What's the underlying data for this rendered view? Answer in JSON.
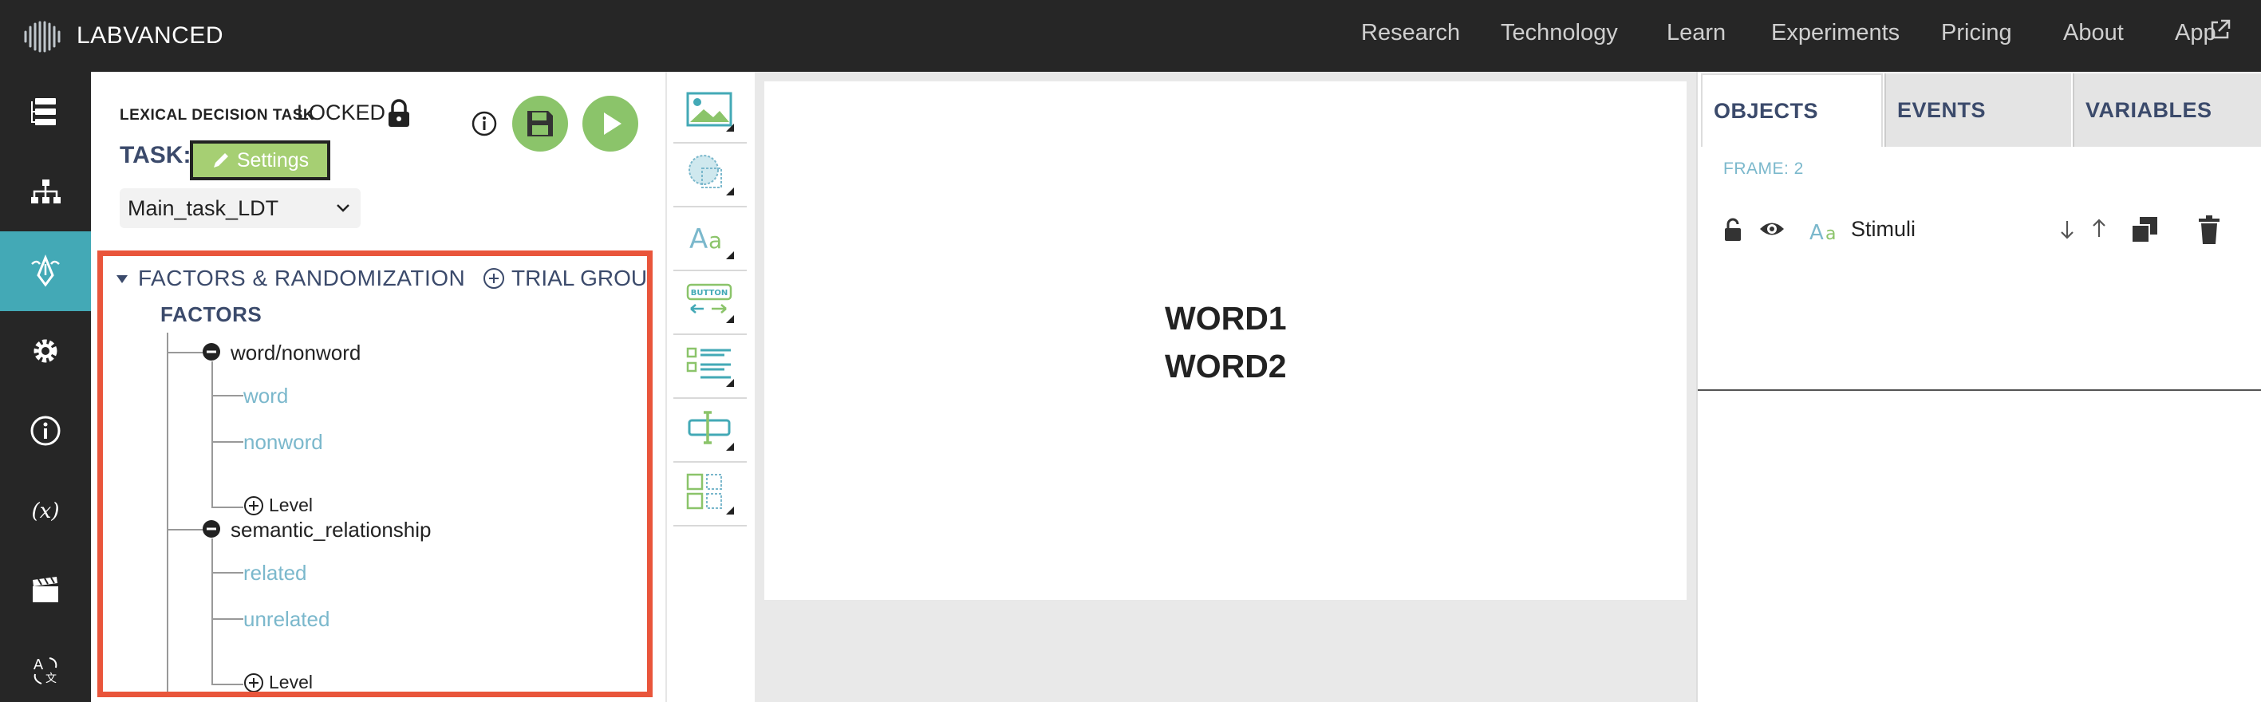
{
  "brand": {
    "name": "LABVANCED"
  },
  "nav": {
    "items": [
      "Research",
      "Technology",
      "Learn",
      "Experiments",
      "Pricing",
      "About",
      "App"
    ]
  },
  "rail": {
    "icons": [
      "structure-icon",
      "tree-icon",
      "task-editor-icon",
      "settings-icon",
      "info-icon",
      "variable-icon",
      "clapper-icon",
      "translate-icon"
    ],
    "active_index": 2,
    "accent": "#43a9b6"
  },
  "task": {
    "name": "LEXICAL DECISION TASK",
    "status": "LOCKED",
    "label": "TASK:",
    "settings_label": "Settings",
    "frame_select_value": "Main_task_LDT"
  },
  "factors_panel": {
    "title": "FACTORS & RANDOMIZATION",
    "trial_group_label": "TRIAL GROUP",
    "factors_label": "FACTORS",
    "factors": [
      {
        "name": "word/nonword",
        "levels": [
          "word",
          "nonword"
        ],
        "add_level_label": "Level"
      },
      {
        "name": "semantic_relationship",
        "levels": [
          "related",
          "unrelated"
        ],
        "add_level_label": "Level"
      }
    ],
    "highlight_color": "#e9553b"
  },
  "tools": [
    "image-tool-icon",
    "shape-tool-icon",
    "text-tool-icon",
    "button-tool-icon",
    "multiple-choice-tool-icon",
    "input-tool-icon",
    "checkbox-tool-icon"
  ],
  "tool_button_text": "BUTTON",
  "canvas": {
    "words": [
      "WORD1",
      "WORD2"
    ]
  },
  "right_panel": {
    "tabs": [
      "OBJECTS",
      "EVENTS",
      "VARIABLES"
    ],
    "active_tab": "OBJECTS",
    "frame_label": "FRAME: 2",
    "objects": [
      {
        "name": "Stimuli",
        "type_icon": "text-type-icon"
      }
    ]
  },
  "colors": {
    "topbar": "#262626",
    "green": "#8bc46a",
    "settings_green": "#a6cf73",
    "link_blue": "#7bb8cc",
    "navy": "#3b4a6b"
  }
}
